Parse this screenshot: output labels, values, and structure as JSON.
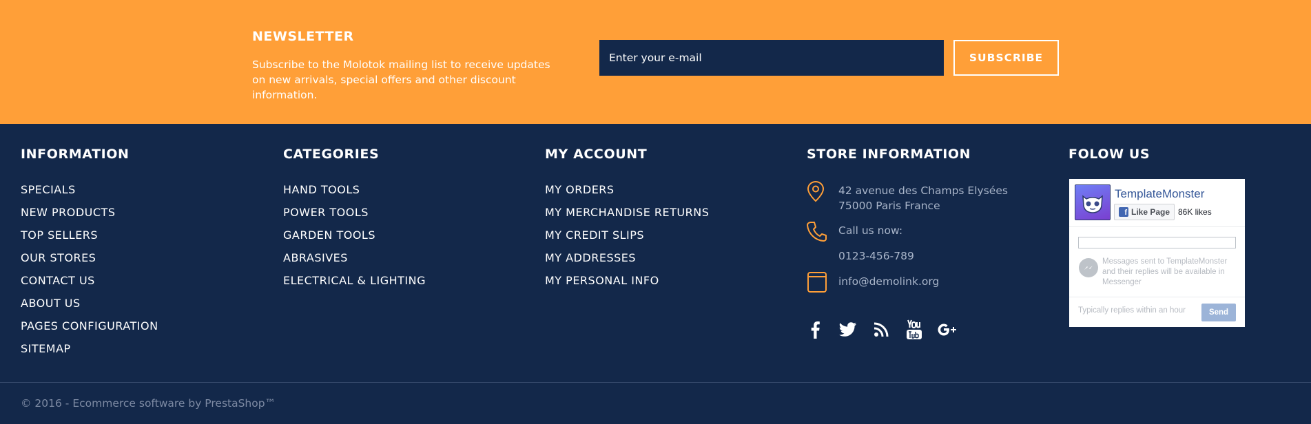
{
  "newsletter": {
    "title": "NEWSLETTER",
    "description": "Subscribe to the Molotok mailing list to receive updates on new arrivals, special offers and other discount information.",
    "email_placeholder": "Enter your e-mail",
    "subscribe_label": "SUBSCRIBE"
  },
  "footer": {
    "information": {
      "title": "INFORMATION",
      "links": [
        "SPECIALS",
        "NEW PRODUCTS",
        "TOP SELLERS",
        "OUR STORES",
        "CONTACT US",
        "ABOUT US",
        "PAGES CONFIGURATION",
        "SITEMAP"
      ]
    },
    "categories": {
      "title": "CATEGORIES",
      "links": [
        "HAND TOOLS",
        "POWER TOOLS",
        "GARDEN TOOLS",
        "ABRASIVES",
        "ELECTRICAL & LIGHTING"
      ]
    },
    "account": {
      "title": "MY ACCOUNT",
      "links": [
        "MY ORDERS",
        "MY MERCHANDISE RETURNS",
        "MY CREDIT SLIPS",
        "MY ADDRESSES",
        "MY PERSONAL INFO"
      ]
    },
    "store": {
      "title": "STORE INFORMATION",
      "address": "42 avenue des Champs Elysées 75000 Paris France",
      "call_label": "Call us now:",
      "phone": "0123-456-789",
      "email": "info@demolink.org",
      "icons": [
        "map-pin-icon",
        "phone-icon",
        "mail-icon"
      ]
    },
    "social": {
      "icons": [
        "facebook-icon",
        "twitter-icon",
        "rss-icon",
        "youtube-icon",
        "google-plus-icon"
      ]
    },
    "follow": {
      "title": "FOLOW US",
      "page_name": "TemplateMonster",
      "like_label": "Like Page",
      "likes": "86K likes",
      "messenger_text": "Messages sent to TemplateMonster and their replies will be available in Messenger",
      "reply_time": "Typically replies within an hour",
      "send_label": "Send"
    },
    "copyright": "© 2016 - Ecommerce software by PrestaShop™"
  },
  "colors": {
    "accent": "#ff9f38",
    "navy": "#13284a",
    "muted_text": "#a9b5c9"
  }
}
